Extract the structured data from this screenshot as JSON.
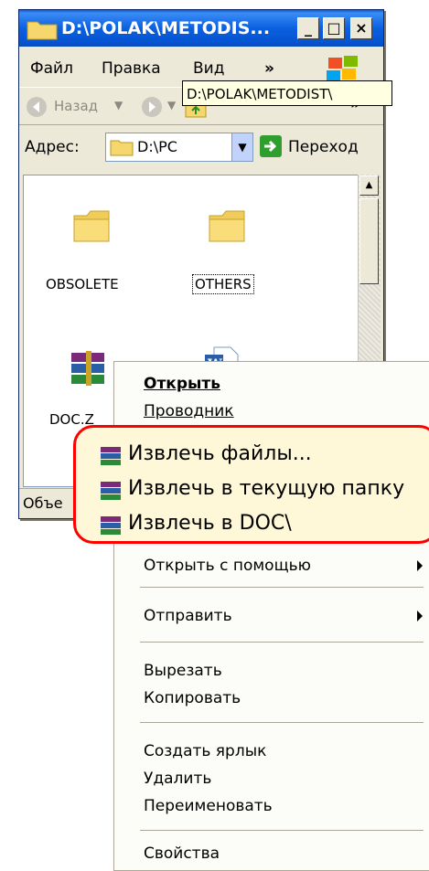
{
  "window": {
    "title": "D:\\POLAK\\METODIS...",
    "menu": [
      "Файл",
      "Правка",
      "Вид",
      "»"
    ],
    "back_label": "Назад",
    "chevron": "»",
    "address_label": "Адрес:",
    "address_value": "D:\\PC",
    "go_label": "Переход",
    "status_text": "Объе"
  },
  "tooltip": "D:\\POLAK\\METODIST\\",
  "files": [
    {
      "name": "OBSOLETE",
      "icon": "folder-icon"
    },
    {
      "name": "OTHERS",
      "icon": "folder-icon"
    },
    {
      "name": "DOC.Z",
      "icon": "winrar-archive-icon"
    },
    {
      "name": "",
      "icon": "word-doc-icon"
    }
  ],
  "context_menu": {
    "items": [
      {
        "label": "Открыть",
        "bold": true
      },
      {
        "label": "Проводник"
      },
      {
        "label": "Открыть с помощью"
      },
      {
        "label": "Отправить"
      },
      {
        "label": "Вырезать"
      },
      {
        "label": "Копировать"
      },
      {
        "label": "Создать ярлык"
      },
      {
        "label": "Удалить"
      },
      {
        "label": "Переименовать"
      },
      {
        "label": "Свойства"
      }
    ]
  },
  "highlight_items": [
    "Извлечь файлы...",
    "Извлечь в текущую папку",
    "Извлечь в DOC\\"
  ],
  "colors": {
    "title_blue": "#0a5fd8",
    "highlight_border": "#ff0000",
    "highlight_fill": "#fff8d8"
  }
}
